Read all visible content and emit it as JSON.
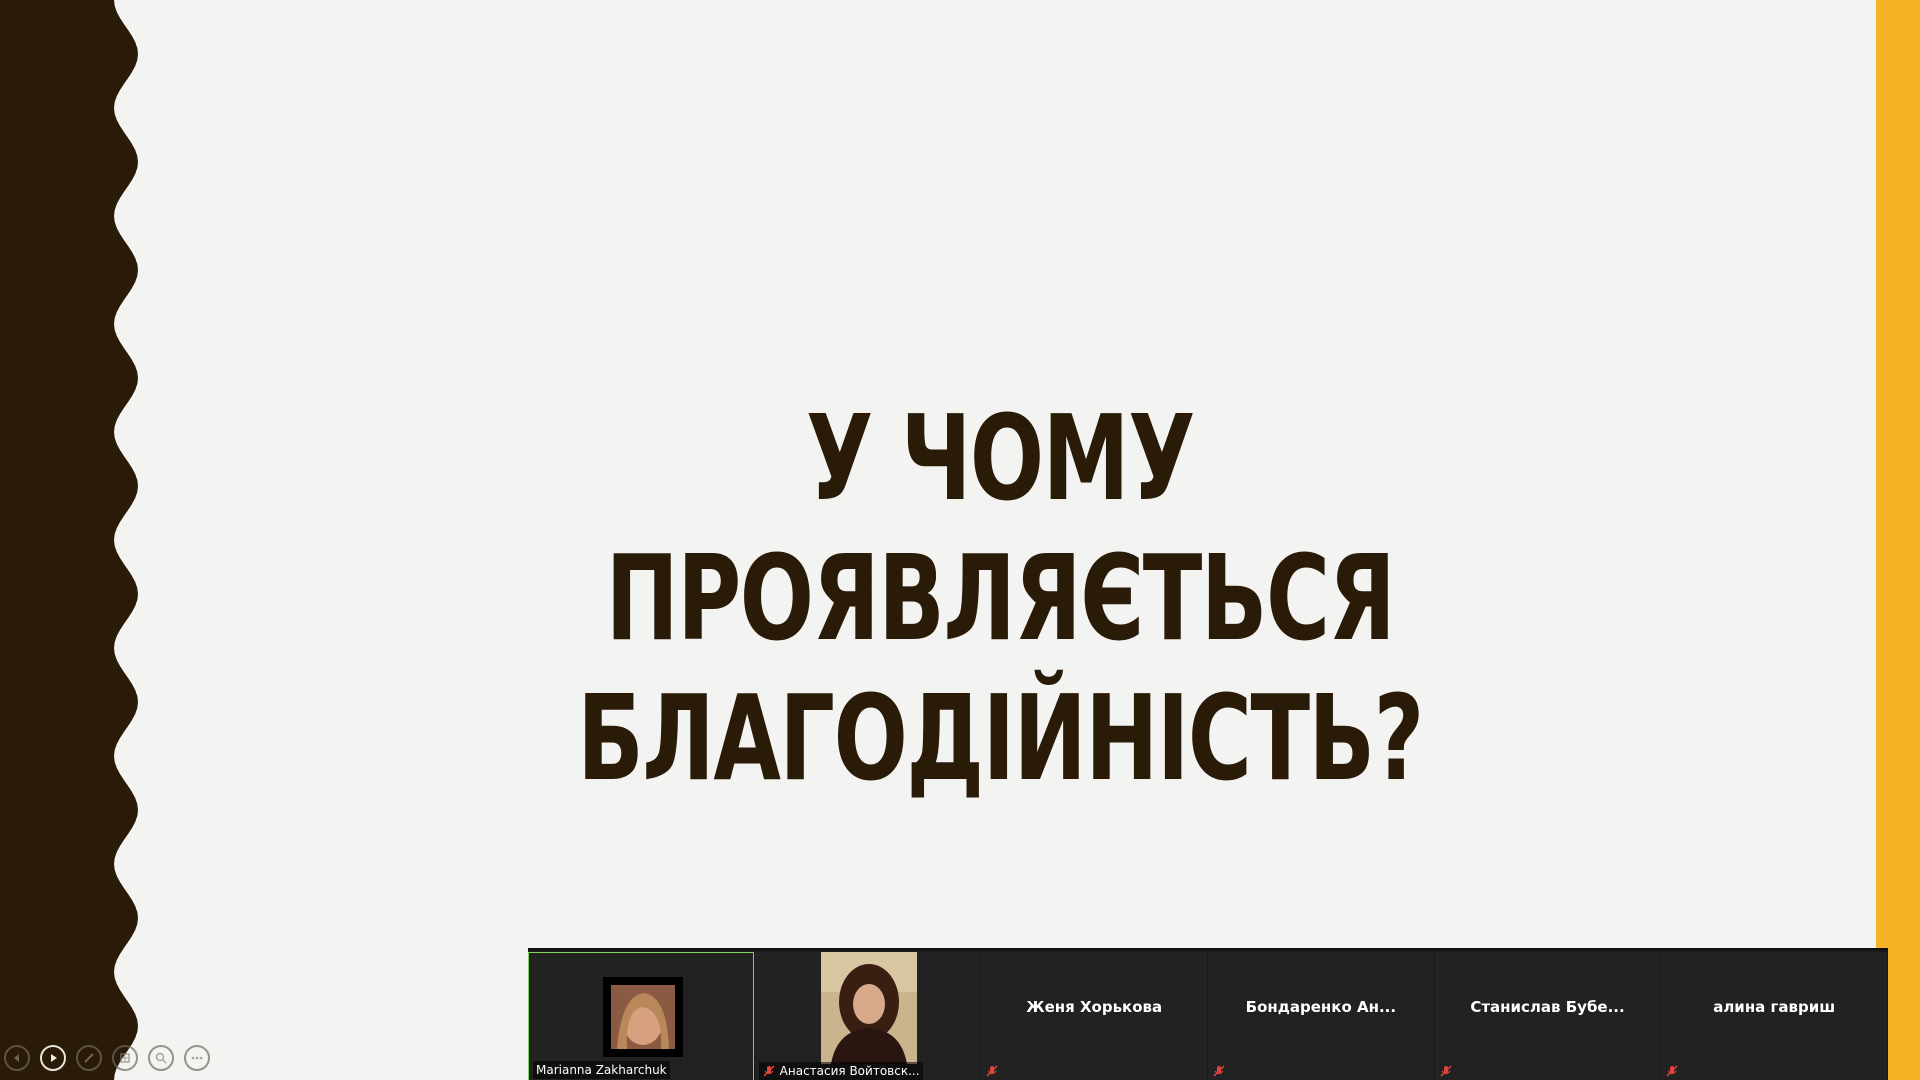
{
  "slide": {
    "title_line1": "У ЧОМУ ПРОЯВЛЯЄТЬСЯ",
    "title_line2": "БЛАГОДІЙНІСТЬ?",
    "colors": {
      "background": "#f3f3f1",
      "left_wave": "#2a1a08",
      "right_bar": "#f5b325",
      "title": "#2a1a08"
    }
  },
  "slideshow_controls": [
    {
      "name": "previous-slide-button",
      "icon": "chevron-left-icon"
    },
    {
      "name": "next-slide-button",
      "icon": "play-icon"
    },
    {
      "name": "pen-tool-button",
      "icon": "pen-icon"
    },
    {
      "name": "see-all-slides-button",
      "icon": "grid-icon"
    },
    {
      "name": "zoom-button",
      "icon": "magnifier-icon"
    },
    {
      "name": "more-options-button",
      "icon": "ellipsis-icon"
    }
  ],
  "participants": [
    {
      "name": "Marianna Zakharchuk",
      "type": "avatar",
      "muted": false,
      "speaking": true
    },
    {
      "name": "Анастасия Войтовск...",
      "type": "video",
      "muted": true,
      "speaking": false
    },
    {
      "name": "Женя Хорькова",
      "type": "name",
      "muted": true,
      "speaking": false
    },
    {
      "name": "Бондаренко  Ан...",
      "type": "name",
      "muted": true,
      "speaking": false
    },
    {
      "name": "Станислав  Бубе...",
      "type": "name",
      "muted": true,
      "speaking": false
    },
    {
      "name": "алина гавриш",
      "type": "name",
      "muted": true,
      "speaking": false
    }
  ],
  "strip": {
    "speaking_border_color": "#7ed957",
    "mute_icon_color": "#e0443a"
  }
}
